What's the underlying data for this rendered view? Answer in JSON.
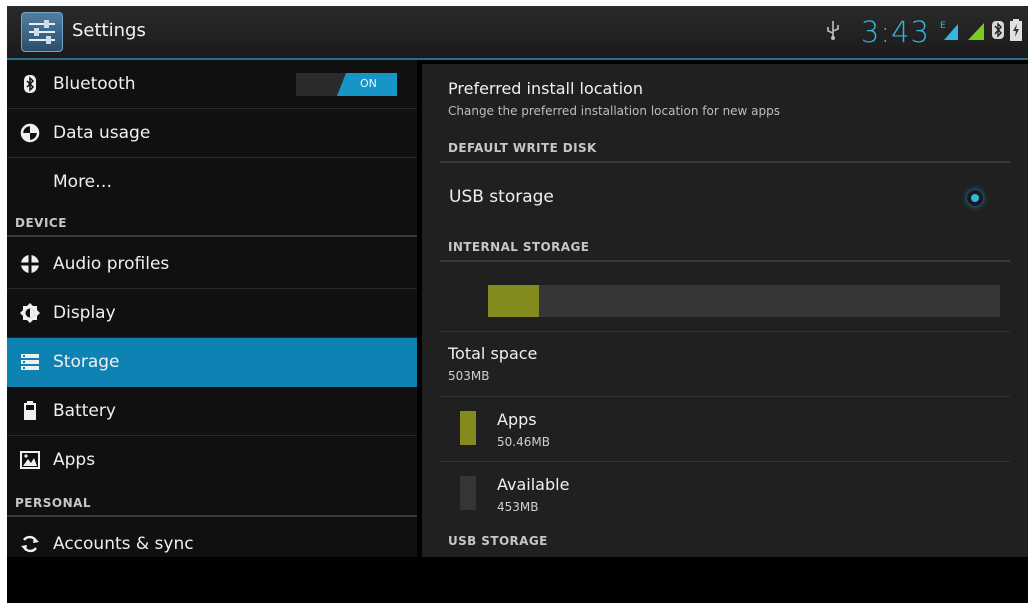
{
  "actionbar": {
    "title": "Settings",
    "clock": "3:43"
  },
  "sidebar": {
    "items": [
      {
        "label": "Bluetooth",
        "icon": "bluetooth-icon",
        "toggle": "ON"
      },
      {
        "label": "Data usage",
        "icon": "data-usage-icon"
      },
      {
        "label": "More…",
        "icon": ""
      }
    ],
    "device_header": "DEVICE",
    "device_items": [
      {
        "label": "Audio profiles",
        "icon": "audio-profiles-icon"
      },
      {
        "label": "Display",
        "icon": "display-icon"
      },
      {
        "label": "Storage",
        "icon": "storage-icon",
        "selected": true
      },
      {
        "label": "Battery",
        "icon": "battery-icon"
      },
      {
        "label": "Apps",
        "icon": "apps-icon"
      }
    ],
    "personal_header": "PERSONAL",
    "personal_items": [
      {
        "label": "Accounts & sync",
        "icon": "sync-icon"
      }
    ]
  },
  "detail": {
    "install_title": "Preferred install location",
    "install_subtitle": "Change the preferred installation location for new apps",
    "default_write_header": "DEFAULT WRITE DISK",
    "usb_option": "USB storage",
    "internal_header": "INTERNAL STORAGE",
    "usage_fraction": 0.1,
    "total_label": "Total space",
    "total_value": "503MB",
    "apps_label": "Apps",
    "apps_value": "50.46MB",
    "available_label": "Available",
    "available_value": "453MB",
    "usb_header": "USB STORAGE"
  },
  "colors": {
    "accent": "#33b5e5",
    "selected": "#0d82b3",
    "apps": "#848b1e",
    "available": "#363636",
    "signal": "#7ecb20"
  }
}
